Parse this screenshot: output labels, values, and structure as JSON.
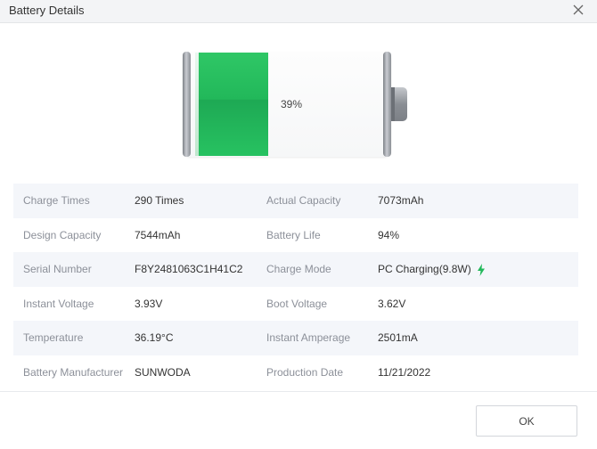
{
  "window": {
    "title": "Battery Details"
  },
  "battery": {
    "percent_label": "39%",
    "level_percent": 39,
    "fill_color": "#22b85a"
  },
  "details": [
    {
      "label1": "Charge Times",
      "value1": "290 Times",
      "label2": "Actual Capacity",
      "value2": "7073mAh"
    },
    {
      "label1": "Design Capacity",
      "value1": "7544mAh",
      "label2": "Battery Life",
      "value2": "94%"
    },
    {
      "label1": "Serial Number",
      "value1": "F8Y2481063C1H41C2",
      "label2": "Charge Mode",
      "value2": "PC Charging(9.8W)"
    },
    {
      "label1": "Instant Voltage",
      "value1": "3.93V",
      "label2": "Boot Voltage",
      "value2": "3.62V"
    },
    {
      "label1": "Temperature",
      "value1": "36.19°C",
      "label2": "Instant Amperage",
      "value2": "2501mA"
    },
    {
      "label1": "Battery Manufacturer",
      "value1": "SUNWODA",
      "label2": "Production Date",
      "value2": "11/21/2022"
    }
  ],
  "icons": {
    "close": "close-icon",
    "charging": "lightning-bolt-icon"
  },
  "colors": {
    "accent_green": "#22b85a",
    "label_gray": "#8c9099",
    "row_alt": "#f4f6fa"
  },
  "footer": {
    "ok_label": "OK"
  }
}
